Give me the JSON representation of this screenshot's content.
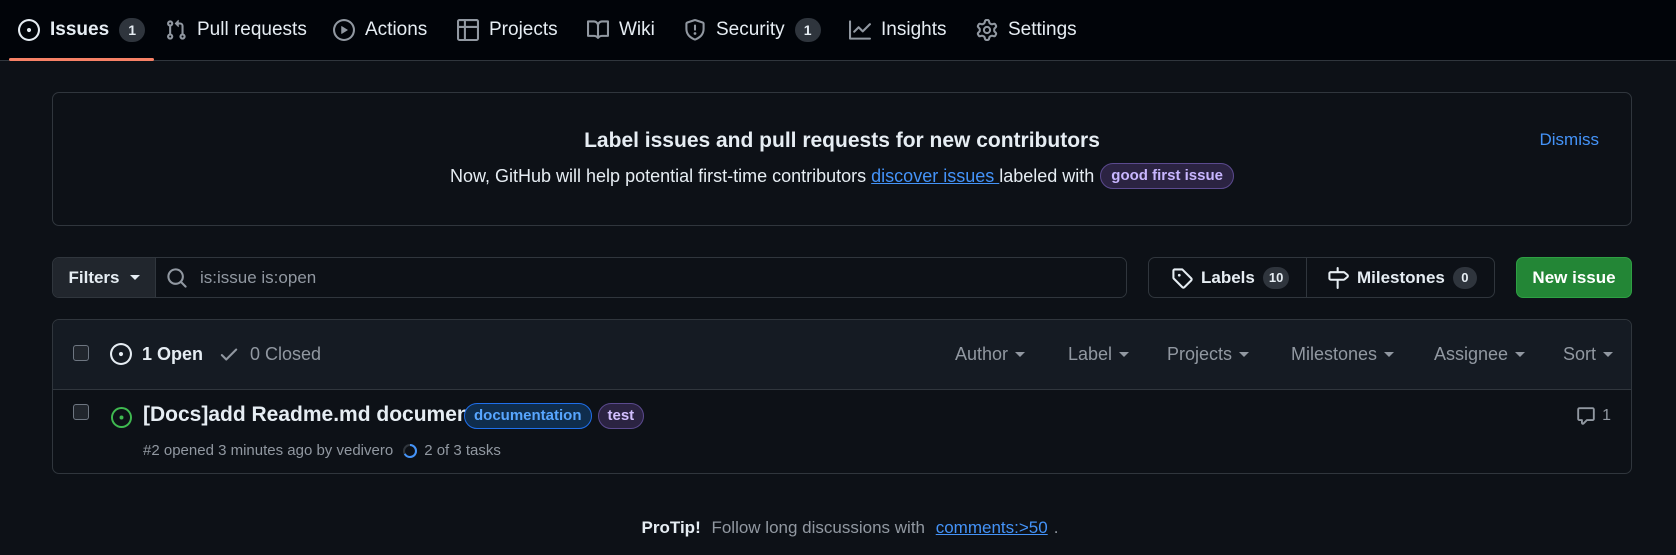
{
  "nav": {
    "tabs": [
      {
        "label": "Issues",
        "count": "1",
        "icon": "issue-opened-icon",
        "active": true
      },
      {
        "label": "Pull requests",
        "icon": "git-pull-request-icon"
      },
      {
        "label": "Actions",
        "icon": "play-icon"
      },
      {
        "label": "Projects",
        "icon": "table-icon"
      },
      {
        "label": "Wiki",
        "icon": "book-icon"
      },
      {
        "label": "Security",
        "count": "1",
        "icon": "shield-icon"
      },
      {
        "label": "Insights",
        "icon": "graph-icon"
      },
      {
        "label": "Settings",
        "icon": "gear-icon"
      }
    ]
  },
  "banner": {
    "title": "Label issues and pull requests for new contributors",
    "text_before": "Now, GitHub will help potential first-time contributors ",
    "link": "discover issues ",
    "text_after": "labeled with",
    "label": "good first issue",
    "dismiss": "Dismiss"
  },
  "filters": {
    "button": "Filters",
    "search_placeholder": "is:issue is:open"
  },
  "labels_button": {
    "label": "Labels",
    "count": "10"
  },
  "milestones_button": {
    "label": "Milestones",
    "count": "0"
  },
  "new_issue": "New issue",
  "issues_header": {
    "open": "1 Open",
    "closed": "0 Closed",
    "menus": [
      "Author",
      "Label",
      "Projects",
      "Milestones",
      "Assignee",
      "Sort"
    ]
  },
  "issues": [
    {
      "title": "[Docs]add Readme.md document",
      "labels": [
        {
          "name": "documentation",
          "color": "#1f6feb"
        },
        {
          "name": "test",
          "color": "#8957e5"
        }
      ],
      "meta": "#2 opened 3 minutes ago by vedivero",
      "tasks": "2 of 3 tasks",
      "tasks_progress": 0.667,
      "comments": "1"
    }
  ],
  "protip": {
    "bold": "ProTip!",
    "text": " Follow long discussions with ",
    "link": "comments:>50",
    "end": "."
  },
  "colors": {
    "accent_underline": "#f78166",
    "link": "#4493f8",
    "new_issue_bg": "#238636",
    "open_issue": "#3fb950"
  }
}
